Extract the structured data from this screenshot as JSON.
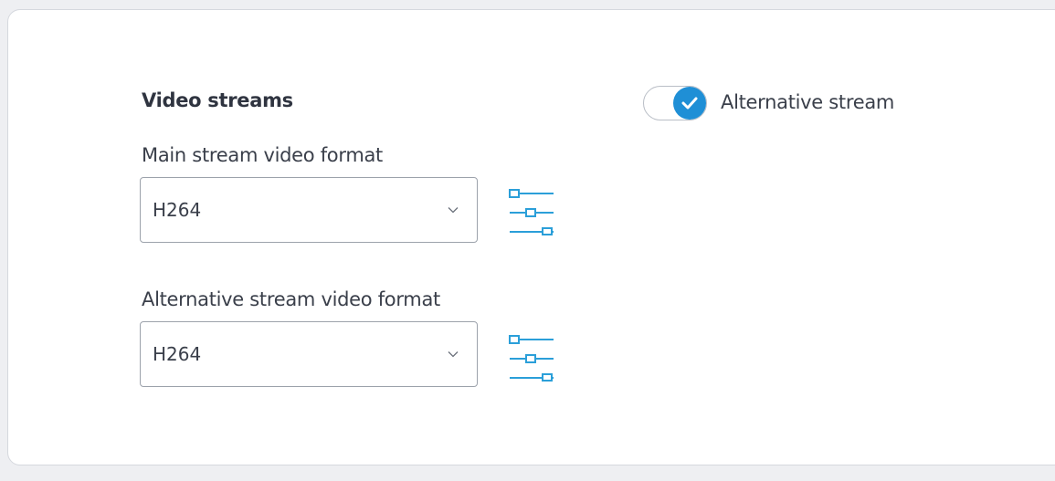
{
  "section": {
    "title": "Video streams"
  },
  "alternative_toggle": {
    "label": "Alternative stream",
    "checked": true
  },
  "main_stream": {
    "label": "Main stream video format",
    "value": "H264"
  },
  "alt_stream": {
    "label": "Alternative stream video format",
    "value": "H264"
  },
  "colors": {
    "accent": "#1f8fd6",
    "icon": "#2b9fd9",
    "border": "#9ca2ab",
    "background": "#eeeff2",
    "card": "#ffffff"
  },
  "icons": {
    "settings": "sliders-icon",
    "dropdown": "chevron-down-icon",
    "check": "check-icon"
  }
}
